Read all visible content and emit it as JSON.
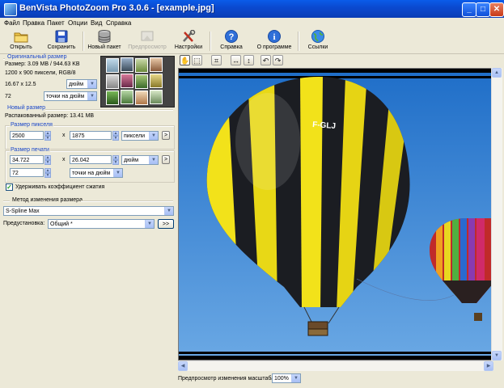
{
  "window": {
    "title": "BenVista PhotoZoom Pro 3.0.6 - [example.jpg]",
    "min": "_",
    "max": "□",
    "close": "✕"
  },
  "menu": [
    "Файл",
    "Правка",
    "Пакет",
    "Опции",
    "Вид",
    "Справка"
  ],
  "toolbar": {
    "open": "Открыть",
    "save": "Сохранить",
    "new_batch": "Новый пакет",
    "preview": "Предпросмотр",
    "settings": "Настройки",
    "help": "Справка",
    "about": "О программе",
    "links": "Ссылки"
  },
  "original": {
    "title": "Оригинальный размер",
    "size": "Размер: 3.09 MB / 944.63 KB",
    "pixels": "1200 x 900 пиксели, RGB/8",
    "dims": "16.67 x 12.5",
    "dims_unit": "дюйм",
    "res": "72",
    "res_unit": "точки на дюйм"
  },
  "new_size": {
    "title": "Новый размер",
    "unpacked": "Распакованный размер: 13.41 MB",
    "pixel_title": "Размер пикселя",
    "px_width": "2500",
    "px_height": "1875",
    "x": "x",
    "px_unit": "пиксели",
    "print_title": "Размер печати",
    "print_width": "34.722",
    "print_height": "26.042",
    "print_unit": "дюйм",
    "print_res": "72",
    "print_res_unit": "точки на дюйм",
    "keep_ratio": "Удерживать коэффициент сжатия",
    "keep_ratio_checked": true,
    "arrow": ">"
  },
  "method": {
    "title": "Метод изменения размера",
    "value": "S-Spline Max",
    "preset_label": "Предустановка:",
    "preset_value": "Общий *",
    "more": ">>"
  },
  "status": {
    "zoom_label": "Предпросмотр изменения масштаба:",
    "zoom_value": "100%"
  },
  "preview": {
    "balloon_text": "F-GLJ"
  },
  "colors": {
    "accent": "#1a46c8",
    "sky": "#4a8fd8",
    "balloon_yellow": "#f2e21a",
    "balloon_dark": "#1b1d22"
  }
}
